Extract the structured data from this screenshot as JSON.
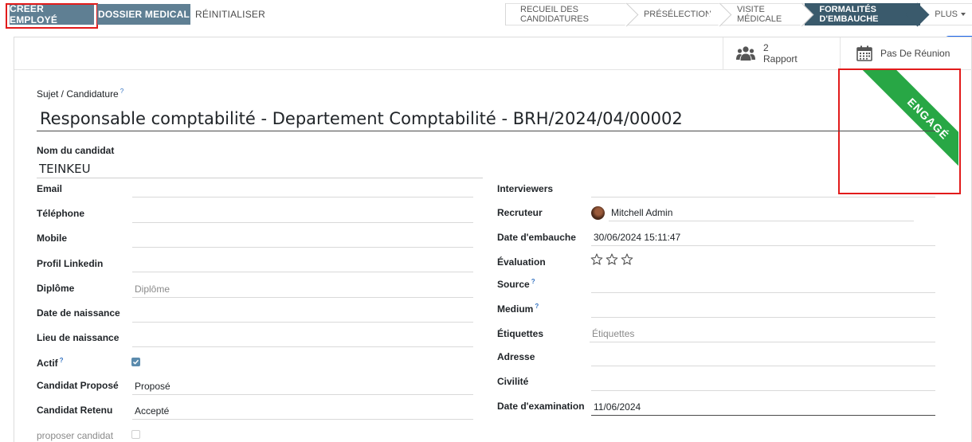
{
  "toolbar": {
    "create_employee": "CRÉER EMPLOYÉ",
    "medical_file": "DOSSIER MEDICAL",
    "reset": "RÉINITIALISER"
  },
  "stages": [
    {
      "label": "RECUEIL DES CANDIDATURES",
      "active": false
    },
    {
      "label": "PRÉSÉLECTION",
      "active": false
    },
    {
      "label": "VISITE MÉDICALE",
      "active": false
    },
    {
      "label": "FORMALITÉS D'EMBAUCHE",
      "active": true
    }
  ],
  "stage_more": "PLUS",
  "stat_buttons": {
    "report_count": "2",
    "report_label": "Rapport",
    "meeting_label": "Pas De Réunion"
  },
  "ribbon": "ENGAGÉ",
  "subject": {
    "label": "Sujet / Candidature",
    "help": "?",
    "value": "Responsable comptabilité - Departement Comptabilité - BRH/2024/04/00002"
  },
  "candidate_name": {
    "label": "Nom du candidat",
    "value": "TEINKEU"
  },
  "left_fields": {
    "email": {
      "label": "Email",
      "value": ""
    },
    "phone": {
      "label": "Téléphone",
      "value": ""
    },
    "mobile": {
      "label": "Mobile",
      "value": ""
    },
    "linkedin": {
      "label": "Profil Linkedin",
      "value": ""
    },
    "diploma": {
      "label": "Diplôme",
      "placeholder": "Diplôme"
    },
    "birthdate": {
      "label": "Date de naissance",
      "value": ""
    },
    "birthplace": {
      "label": "Lieu de naissance",
      "value": ""
    },
    "active": {
      "label": "Actif",
      "help": "?",
      "checked": true
    },
    "proposed": {
      "label": "Candidat Proposé",
      "value": "Proposé"
    },
    "retained": {
      "label": "Candidat Retenu",
      "value": "Accepté"
    },
    "propose_candidate": {
      "label": "proposer candidat",
      "checked": false
    }
  },
  "right_fields": {
    "interviewers": {
      "label": "Interviewers",
      "value": ""
    },
    "recruiter": {
      "label": "Recruteur",
      "value": "Mitchell Admin"
    },
    "hire_date": {
      "label": "Date d'embauche",
      "value": "30/06/2024 15:11:47"
    },
    "evaluation": {
      "label": "Évaluation",
      "stars": 0,
      "max": 3
    },
    "source": {
      "label": "Source",
      "help": "?",
      "value": ""
    },
    "medium": {
      "label": "Medium",
      "help": "?",
      "value": ""
    },
    "tags": {
      "label": "Étiquettes",
      "placeholder": "Étiquettes"
    },
    "address": {
      "label": "Adresse",
      "value": ""
    },
    "civility": {
      "label": "Civilité",
      "value": ""
    },
    "exam_date": {
      "label": "Date d'examination",
      "value": "11/06/2024"
    }
  },
  "icons": {
    "report": "users-icon",
    "meeting": "calendar-icon",
    "side_toggle": "chevron-left-icon",
    "rating": "star-outline-icon",
    "check": "check-icon"
  },
  "colors": {
    "primary_button": "#5f7f93",
    "active_stage": "#3a5a6c",
    "ribbon": "#28a745",
    "side_toggle": "#1a66ee",
    "highlight_box": "#e21b1b"
  }
}
